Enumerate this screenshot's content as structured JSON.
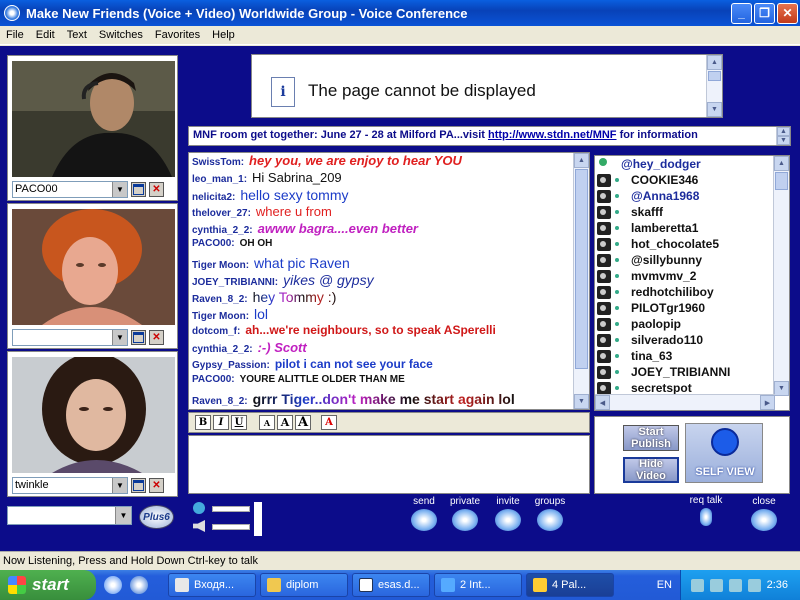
{
  "window": {
    "title": "Make New Friends (Voice + Video) Worldwide Group - Voice Conference"
  },
  "menu": [
    "File",
    "Edit",
    "Text",
    "Switches",
    "Favorites",
    "Help"
  ],
  "cams": [
    {
      "name": "PACO00"
    },
    {
      "name": ""
    },
    {
      "name": "twinkle"
    }
  ],
  "plus_label": "Plus6",
  "ad": {
    "message": "The page cannot be displayed"
  },
  "ticker": {
    "text": "MNF room get together: June 27 - 28 at Milford PA...visit ",
    "link": "http://www.stdn.net/MNF",
    "suffix": " for information"
  },
  "chat": [
    {
      "nick": "SwissTom:",
      "text": "hey you, we are enjoy to hear YOU",
      "color": "#e02020",
      "style": "italic-bold"
    },
    {
      "nick": "leo_man_1:",
      "text": "Hi Sabrina_209",
      "color": "#111111",
      "style": "plain"
    },
    {
      "nick": "nelicita2:",
      "text": "hello sexy tommy",
      "color": "#1c3cc8",
      "style": "plain-large"
    },
    {
      "nick": "thelover_27:",
      "text": "where u from",
      "color": "#e02020",
      "style": "plain"
    },
    {
      "nick": "cynthia_2_2:",
      "text": "awww bagra....even better",
      "color": "#c020c0",
      "style": "italic-bold"
    },
    {
      "nick": "PACO00:",
      "text": "OH OH",
      "color": "#111111",
      "style": "bold-small"
    },
    {
      "nick": "Tiger Moon:",
      "text": "what pic Raven",
      "color": "#1c3cc8",
      "style": "plain-large"
    },
    {
      "nick": "JOEY_TRIBIANNI:",
      "text": "yikes @ gypsy",
      "color": "#1c2c9c",
      "style": "italic-large"
    },
    {
      "nick": "Raven_8_2:",
      "text": "hey Tommy :)",
      "color": "#111111",
      "style": "rainbow"
    },
    {
      "nick": "Tiger Moon:",
      "text": "lol",
      "color": "#1c3cc8",
      "style": "plain-large"
    },
    {
      "nick": "dotcom_f:",
      "text": "ah...we're neighbours, so to speak ASperelli",
      "color": "#d01818",
      "style": "bold-medium"
    },
    {
      "nick": "cynthia_2_2:",
      "text": ":-) Scott",
      "color": "#c020c0",
      "style": "italic-bold"
    },
    {
      "nick": "Gypsy_Passion:",
      "text": "pilot i can not see your face",
      "color": "#1c3cc8",
      "style": "bold-medium"
    },
    {
      "nick": "PACO00:",
      "text": "YOURE ALITTLE OLDER THAN ME",
      "color": "#111111",
      "style": "bold-small"
    },
    {
      "nick": "Raven_8_2:",
      "text": "grrr Tiger..don't make me start again lol",
      "color": "#111111",
      "style": "rainbow-bold"
    }
  ],
  "users": [
    {
      "name": "@hey_dodger",
      "color": "#1c2c9c",
      "icon": "mic"
    },
    {
      "name": "COOKIE346",
      "color": "#111111",
      "icon": "cam"
    },
    {
      "name": "@Anna1968",
      "color": "#1c2c9c",
      "icon": "cam"
    },
    {
      "name": "skafff",
      "color": "#111111",
      "icon": "cam"
    },
    {
      "name": "lamberetta1",
      "color": "#111111",
      "icon": "cam"
    },
    {
      "name": "hot_chocolate5",
      "color": "#111111",
      "icon": "cam"
    },
    {
      "name": "@sillybunny",
      "color": "#111111",
      "icon": "cam"
    },
    {
      "name": "mvmvmv_2",
      "color": "#111111",
      "icon": "cam"
    },
    {
      "name": "redhotchiliboy",
      "color": "#111111",
      "icon": "cam"
    },
    {
      "name": "PILOTgr1960",
      "color": "#111111",
      "icon": "cam"
    },
    {
      "name": "paolopip",
      "color": "#111111",
      "icon": "cam"
    },
    {
      "name": "silverado110",
      "color": "#111111",
      "icon": "cam"
    },
    {
      "name": "tina_63",
      "color": "#111111",
      "icon": "cam"
    },
    {
      "name": "JOEY_TRIBIANNI",
      "color": "#111111",
      "icon": "cam"
    },
    {
      "name": "secretspot",
      "color": "#111111",
      "icon": "cam"
    }
  ],
  "format": {
    "bold": "B",
    "italic": "I",
    "underline": "U",
    "a1": "A",
    "a2": "A",
    "a3": "A",
    "color": "A"
  },
  "publish": {
    "start": "Start Publish",
    "hide": "Hide Video",
    "selfview": "SELF VIEW"
  },
  "tools": {
    "send": "send",
    "private": "private",
    "invite": "invite",
    "groups": "groups",
    "reqtalk": "req talk",
    "close": "close"
  },
  "status": "Now Listening, Press and Hold Down Ctrl-key to talk",
  "taskbar": {
    "start": "start",
    "tasks": [
      "Входя...",
      "diplom",
      "esas.d...",
      "2 Int...",
      "4 Pal..."
    ],
    "lang": "EN",
    "time": "2:36"
  }
}
